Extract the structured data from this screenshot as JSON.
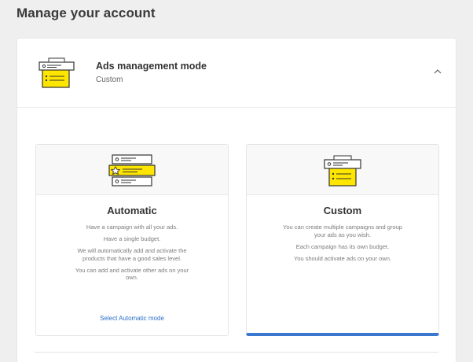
{
  "page": {
    "title": "Manage your account"
  },
  "ads_mode": {
    "title": "Ads management mode",
    "current": "Custom"
  },
  "modes": {
    "automatic": {
      "name": "Automatic",
      "lines": [
        "Have a campaign with all your ads.",
        "Have a single budget.",
        "We will automatically add and activate the products that have a good sales level.",
        "You can add and activate other ads on your own."
      ],
      "action": "Select Automatic mode"
    },
    "custom": {
      "name": "Custom",
      "lines": [
        "You can create multiple campaigns and group your ads as you wish.",
        "Each campaign has its own budget.",
        "You should activate ads on your own."
      ]
    }
  },
  "colors": {
    "accent_yellow": "#ffe600",
    "link_blue": "#2b6fc6",
    "selected_bar": "#3a78d0"
  },
  "icons": [
    "ads-panel-icon",
    "chevron-up-icon",
    "automatic-mode-icon",
    "star-icon",
    "custom-mode-icon"
  ]
}
